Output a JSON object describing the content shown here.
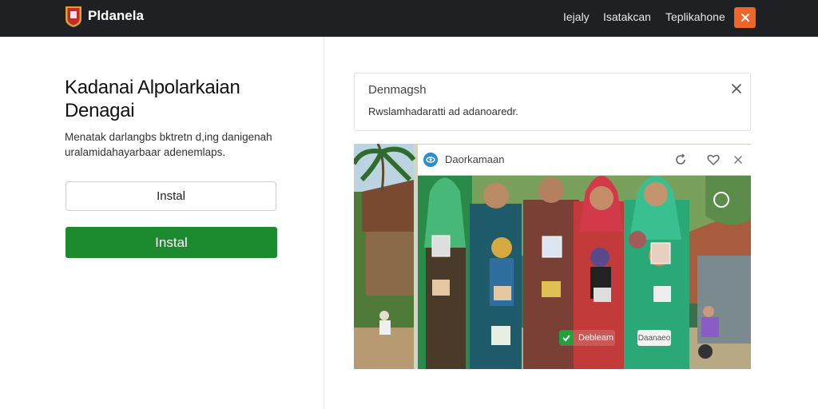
{
  "header": {
    "brand": "Pldanela",
    "nav": [
      "Iejaly",
      "Isatakcan",
      "Teplikahone"
    ],
    "close_icon": "close-icon",
    "accent_color": "#f06529"
  },
  "hero": {
    "title": "Kadanai Alpolarkaian Denagai",
    "description": "Menatak darlangbs bktretn d,ing danigenah uralamidahayarbaar adenemlaps.",
    "secondary_button": "Instal",
    "primary_button": "Instal",
    "primary_color": "#1c8a2e"
  },
  "notice": {
    "title": "Denmagsh",
    "body": "Rwslamhadaratti ad adanoaredr."
  },
  "media_card": {
    "title": "Daorkamaan",
    "header_icons": [
      "eye-icon",
      "refresh-icon",
      "heart-icon",
      "close-icon"
    ],
    "badge_label": "Debleam",
    "secondary_badge": "Daanaeo"
  }
}
